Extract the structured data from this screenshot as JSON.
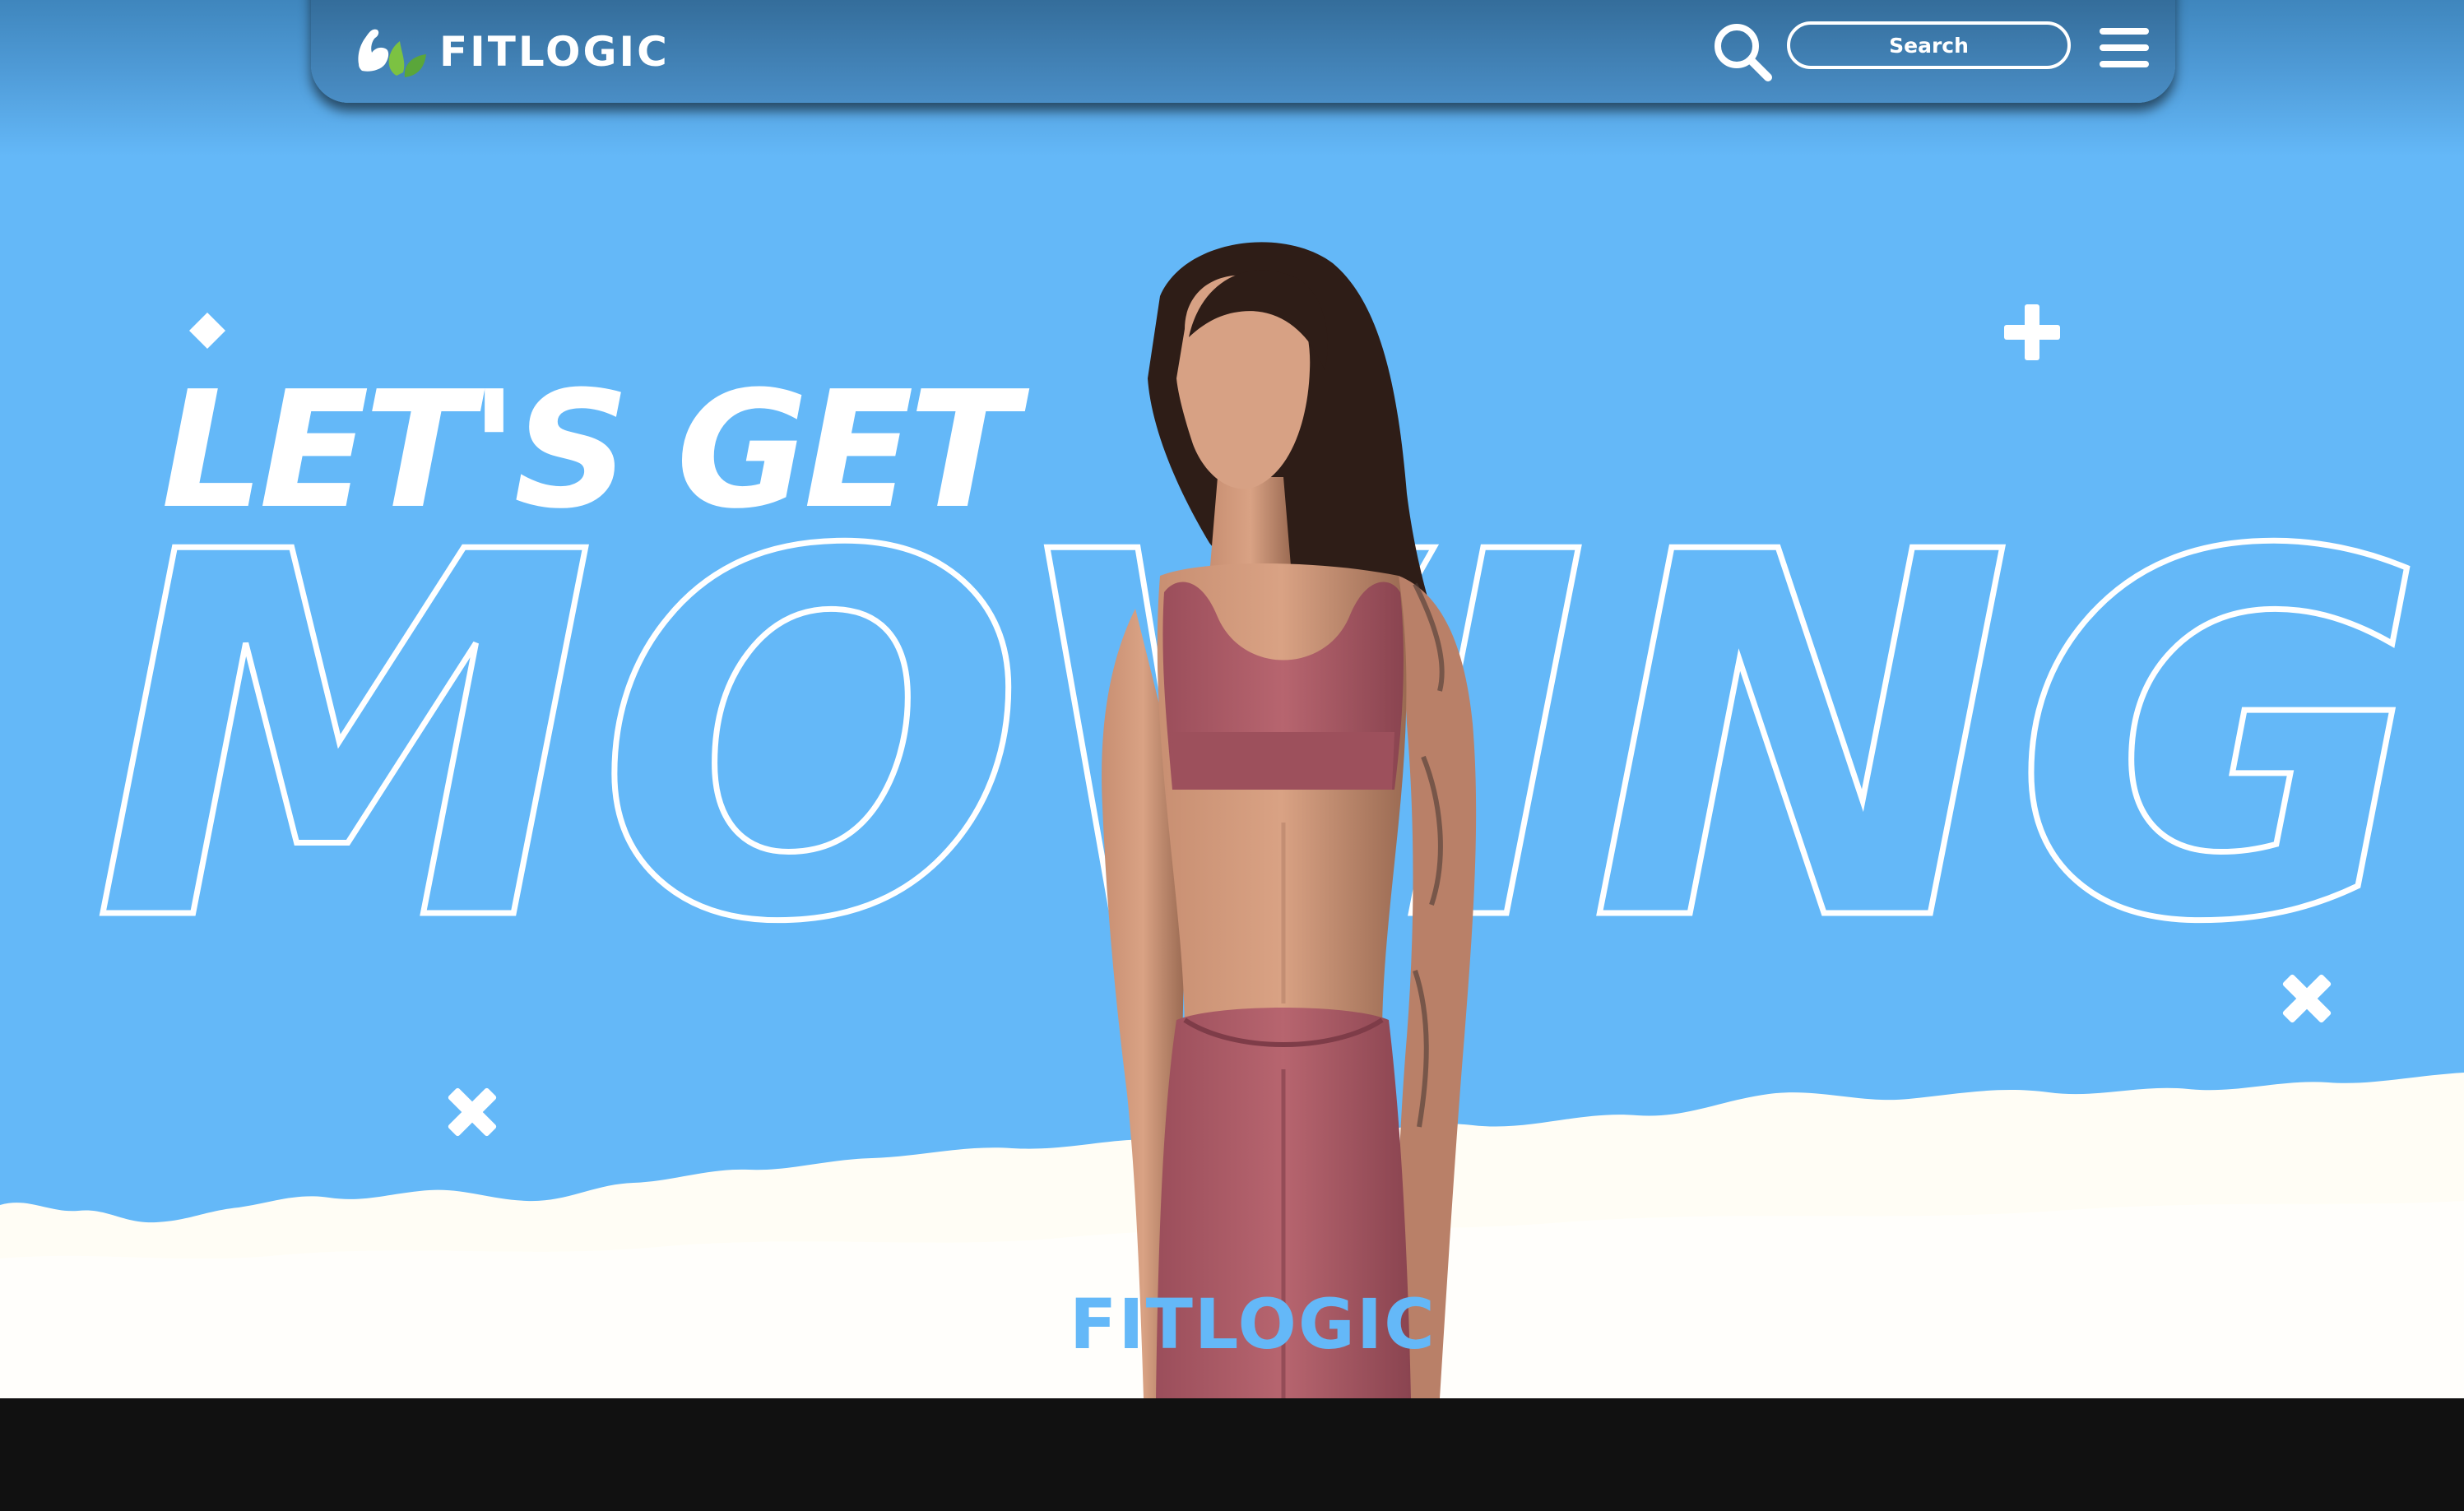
{
  "nav": {
    "brand": "FITLOGIC",
    "search_placeholder": "Search"
  },
  "hero": {
    "headline_line1": "LET'S GET",
    "headline_line2": "MOVING"
  },
  "footer_brand": "FITLOGIC",
  "colors": {
    "sky": "#64b8f8",
    "nav": "#3f7fb5",
    "cloud": "#fffdf5",
    "footer": "#111111",
    "outfit": "#a85a66",
    "logo_green": "#7cc242",
    "white": "#ffffff"
  },
  "icons": [
    "logo-mark-icon",
    "search-icon",
    "hamburger-menu-icon",
    "diamond-icon",
    "plus-icon",
    "x-cross-icon"
  ]
}
